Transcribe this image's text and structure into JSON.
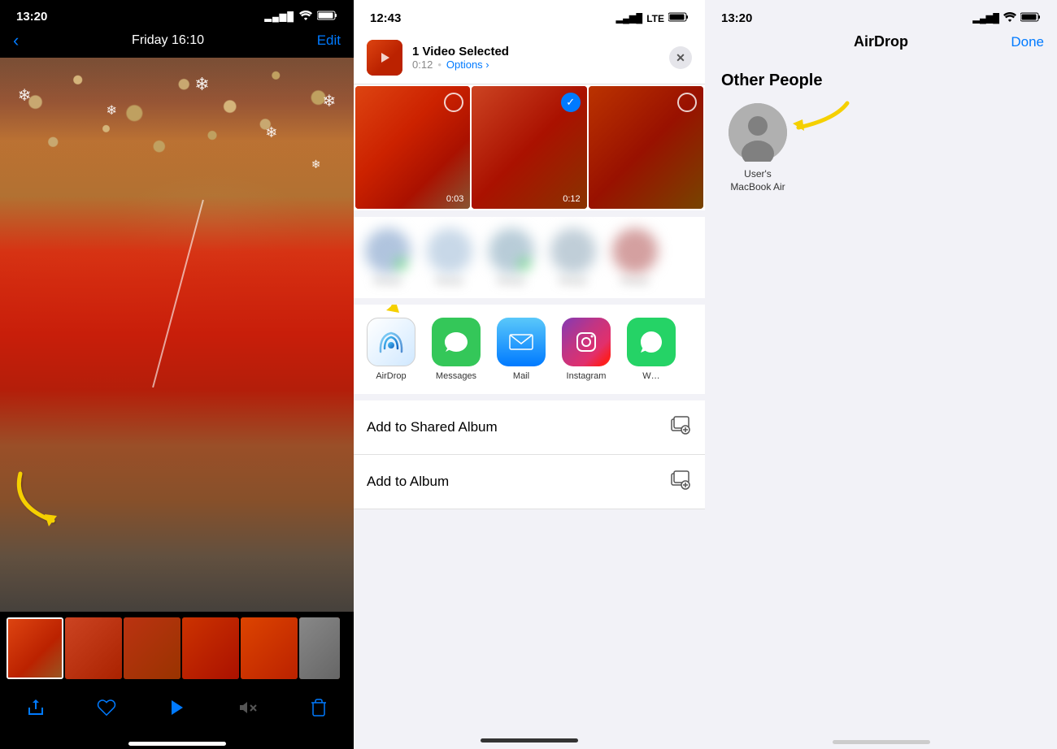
{
  "phone1": {
    "status": {
      "time": "13:20",
      "signal": "●●●●",
      "wifi": "wifi",
      "battery": "battery"
    },
    "nav": {
      "back": "‹",
      "date": "Friday  16:10",
      "edit": "Edit"
    },
    "toolbar": {
      "share": "share",
      "heart": "heart",
      "play": "play",
      "mute": "mute",
      "trash": "trash"
    }
  },
  "phone2": {
    "status": {
      "time": "12:43",
      "lte": "LTE",
      "battery": "battery"
    },
    "share": {
      "title": "1 Video Selected",
      "duration": "0:12",
      "options": "Options ›",
      "close": "✕"
    },
    "videos": [
      {
        "duration": "0:03",
        "selected": false
      },
      {
        "duration": "0:12",
        "selected": true
      },
      {
        "duration": "",
        "selected": false
      }
    ],
    "apps": [
      {
        "name": "AirDrop",
        "type": "airdrop"
      },
      {
        "name": "Messages",
        "type": "messages"
      },
      {
        "name": "Mail",
        "type": "mail"
      },
      {
        "name": "Instagram",
        "type": "instagram"
      },
      {
        "name": "W…",
        "type": "whatsapp"
      }
    ],
    "actions": [
      {
        "label": "Add to Shared Album",
        "icon": "📚"
      },
      {
        "label": "Add to Album",
        "icon": "📚"
      }
    ]
  },
  "phone3": {
    "status": {
      "time": "13:20",
      "signal": "signal",
      "wifi": "wifi",
      "battery": "battery"
    },
    "title": "AirDrop",
    "done": "Done",
    "section": {
      "title": "Other People",
      "device": {
        "name": "User's\nMacBook Air"
      }
    }
  }
}
